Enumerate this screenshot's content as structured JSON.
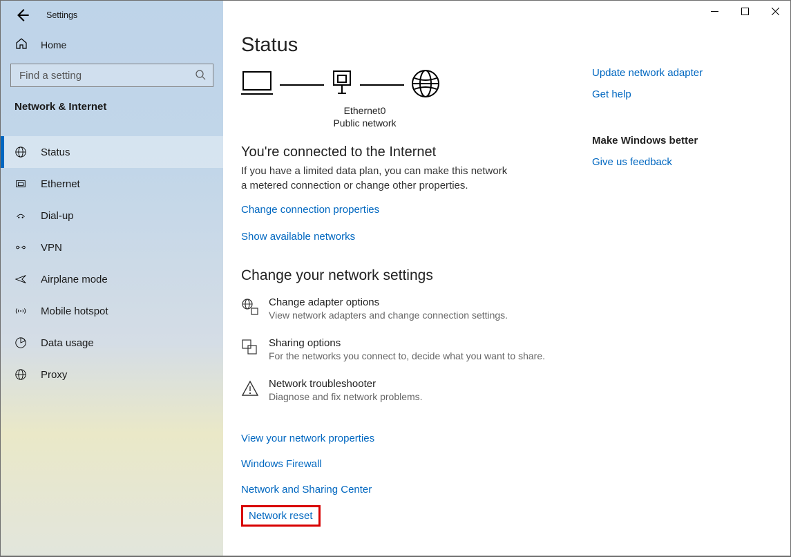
{
  "app": {
    "title": "Settings"
  },
  "sidebar": {
    "home": "Home",
    "search_placeholder": "Find a setting",
    "section": "Network & Internet",
    "items": [
      {
        "label": "Status"
      },
      {
        "label": "Ethernet"
      },
      {
        "label": "Dial-up"
      },
      {
        "label": "VPN"
      },
      {
        "label": "Airplane mode"
      },
      {
        "label": "Mobile hotspot"
      },
      {
        "label": "Data usage"
      },
      {
        "label": "Proxy"
      }
    ]
  },
  "main": {
    "title": "Status",
    "diagram": {
      "adapter": "Ethernet0",
      "type": "Public network"
    },
    "connected_heading": "You're connected to the Internet",
    "connected_body": "If you have a limited data plan, you can make this network a metered connection or change other properties.",
    "change_conn_link": "Change connection properties",
    "show_networks_link": "Show available networks",
    "change_settings_heading": "Change your network settings",
    "rows": [
      {
        "title": "Change adapter options",
        "sub": "View network adapters and change connection settings."
      },
      {
        "title": "Sharing options",
        "sub": "For the networks you connect to, decide what you want to share."
      },
      {
        "title": "Network troubleshooter",
        "sub": "Diagnose and fix network problems."
      }
    ],
    "links": [
      "View your network properties",
      "Windows Firewall",
      "Network and Sharing Center"
    ],
    "highlight_link": "Network reset"
  },
  "right": {
    "update_link": "Update network adapter",
    "help_link": "Get help",
    "better_heading": "Make Windows better",
    "feedback_link": "Give us feedback"
  }
}
